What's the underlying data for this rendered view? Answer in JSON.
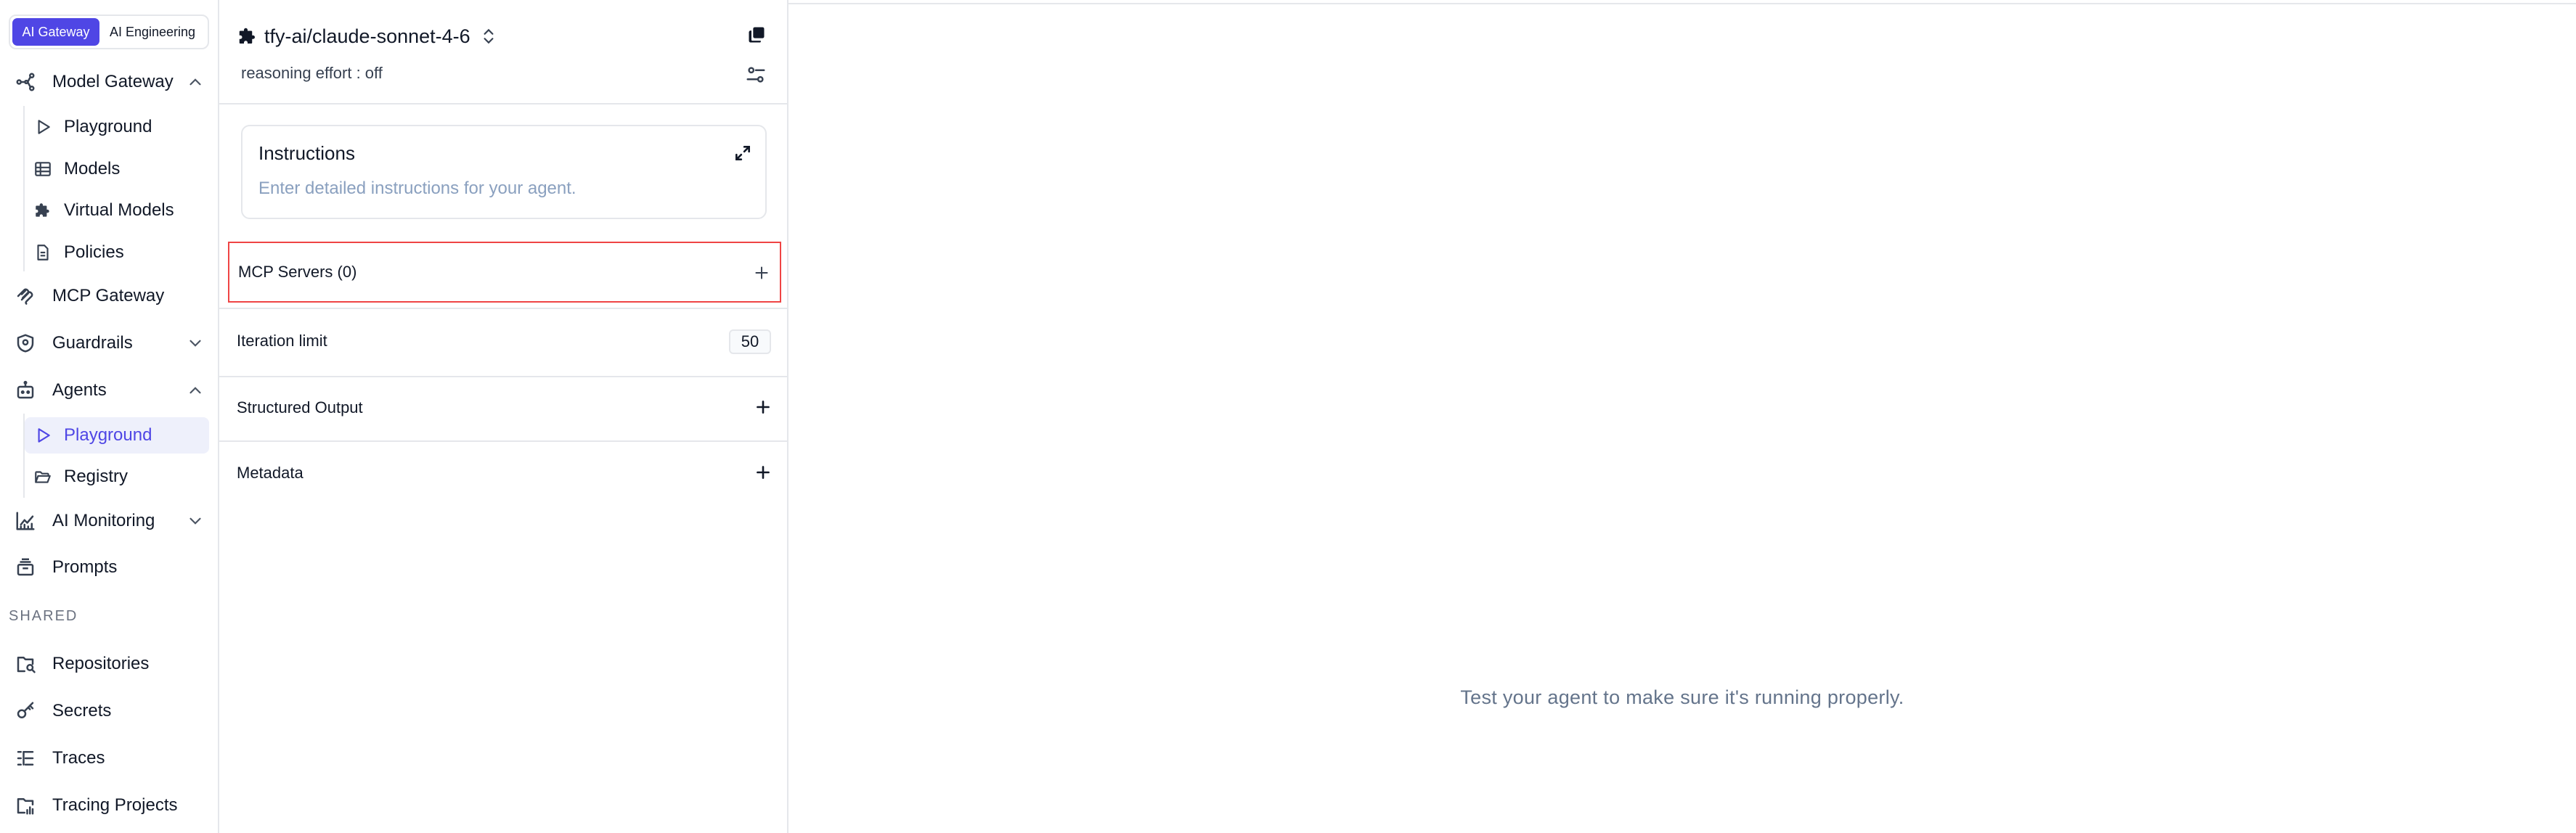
{
  "sidebar": {
    "switcher": {
      "active": "AI Gateway",
      "inactive": "AI Engineering"
    },
    "model_gateway": {
      "label": "Model Gateway",
      "children": [
        "Playground",
        "Models",
        "Virtual Models",
        "Policies"
      ]
    },
    "mcp_gateway": "MCP Gateway",
    "guardrails": "Guardrails",
    "agents": {
      "label": "Agents",
      "children": [
        "Playground",
        "Registry"
      ]
    },
    "ai_monitoring": "AI Monitoring",
    "prompts": "Prompts",
    "shared_label": "SHARED",
    "shared": [
      "Repositories",
      "Secrets",
      "Traces",
      "Tracing Projects"
    ]
  },
  "config": {
    "model_name": "tfy-ai/claude-sonnet-4-6",
    "reasoning": "reasoning effort : off",
    "instructions": {
      "title": "Instructions",
      "placeholder": "Enter detailed instructions for your agent."
    },
    "mcp_servers": "MCP Servers (0)",
    "iteration_limit": {
      "label": "Iteration limit",
      "value": "50"
    },
    "structured_output": "Structured Output",
    "metadata": "Metadata"
  },
  "main": {
    "empty_message": "Test your agent to make sure it's running properly."
  },
  "colors": {
    "accent": "#4f46e5",
    "active_bg": "#eef0fb",
    "highlight_border": "#ef4444",
    "muted_text": "#64748b"
  }
}
